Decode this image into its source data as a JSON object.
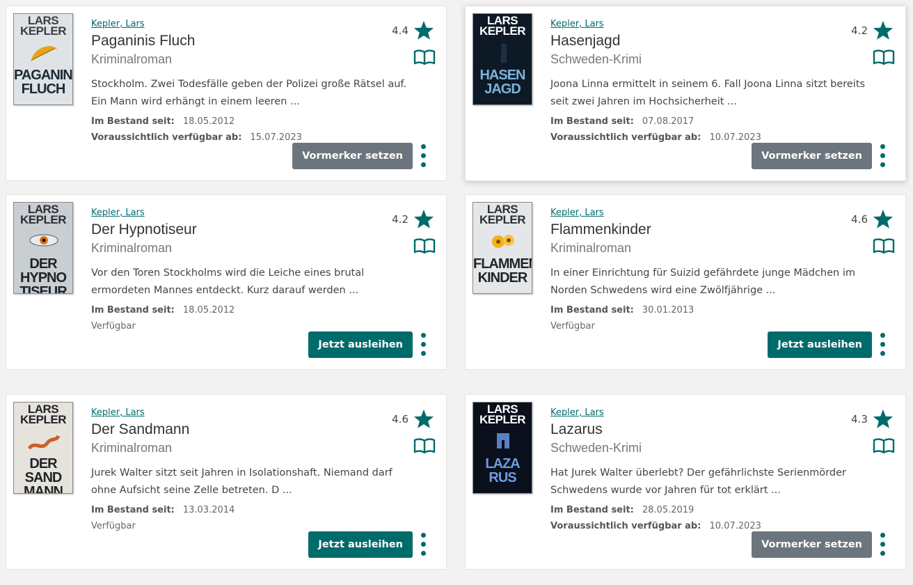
{
  "labels": {
    "in_stock_since": "Im Bestand seit:",
    "expected_available": "Voraussichtlich verfügbar ab:"
  },
  "colors": {
    "accent": "#006b6b",
    "reserve": "#6c757d"
  },
  "icons": {
    "rating": "star-icon",
    "format": "book-open-icon",
    "menu": "more-vertical-icon"
  },
  "books": [
    {
      "author": "Kepler, Lars",
      "title": "Paganinis Fluch",
      "subtitle": "Kriminalroman",
      "description": "Stockholm. Zwei Todesfälle geben der Polizei große Rätsel auf. Ein Mann wird erhängt in einem leeren ...",
      "rating": "4.4",
      "in_stock_since": "18.05.2012",
      "available_from": "15.07.2023",
      "status": "",
      "button": "Vormerker setzen",
      "cover": {
        "author": "LARS KEPLER",
        "title": "PAGANINIS FLUCH"
      }
    },
    {
      "author": "Kepler, Lars",
      "title": "Hasenjagd",
      "subtitle": "Schweden-Krimi",
      "description": "Joona Linna ermittelt in seinem 6. Fall Joona Linna sitzt bereits seit zwei Jahren im Hochsicherheit ...",
      "rating": "4.2",
      "in_stock_since": "07.08.2017",
      "available_from": "10.07.2023",
      "status": "",
      "button": "Vormerker setzen",
      "cover": {
        "author": "LARS KEPLER",
        "title": "HASEN JAGD"
      }
    },
    {
      "author": "Kepler, Lars",
      "title": "Der Hypnotiseur",
      "subtitle": "Kriminalroman",
      "description": "Vor den Toren Stockholms wird die Leiche eines brutal ermordeten Mannes entdeckt. Kurz darauf werden ...",
      "rating": "4.2",
      "in_stock_since": "18.05.2012",
      "available_from": "",
      "status": "Verfügbar",
      "button": "Jetzt ausleihen",
      "cover": {
        "author": "LARS KEPLER",
        "title": "DER HYPNO TISEUR"
      }
    },
    {
      "author": "Kepler, Lars",
      "title": "Flammenkinder",
      "subtitle": "Kriminalroman",
      "description": "In einer Einrichtung für Suizid gefährdete junge Mädchen im Norden Schwedens wird eine Zwölfjährige  ...",
      "rating": "4.6",
      "in_stock_since": "30.01.2013",
      "available_from": "",
      "status": "Verfügbar",
      "button": "Jetzt ausleihen",
      "cover": {
        "author": "LARS KEPLER",
        "title": "FLAMMEN KINDER"
      }
    },
    {
      "author": "Kepler, Lars",
      "title": "Der Sandmann",
      "subtitle": "Kriminalroman",
      "description": "Jurek Walter sitzt seit Jahren in Isolationshaft. Niemand darf ohne Aufsicht seine Zelle betreten. D ...",
      "rating": "4.6",
      "in_stock_since": "13.03.2014",
      "available_from": "",
      "status": "Verfügbar",
      "button": "Jetzt ausleihen",
      "cover": {
        "author": "LARS KEPLER",
        "title": "DER SAND MANN"
      }
    },
    {
      "author": "Kepler, Lars",
      "title": "Lazarus",
      "subtitle": "Schweden-Krimi",
      "description": "Hat Jurek Walter überlebt? Der gefährlichste Serienmörder Schwedens wurde vor Jahren für tot erklärt ...",
      "rating": "4.3",
      "in_stock_since": "28.05.2019",
      "available_from": "10.07.2023",
      "status": "",
      "button": "Vormerker setzen",
      "cover": {
        "author": "LARS KEPLER",
        "title": "LAZA RUS"
      }
    }
  ]
}
